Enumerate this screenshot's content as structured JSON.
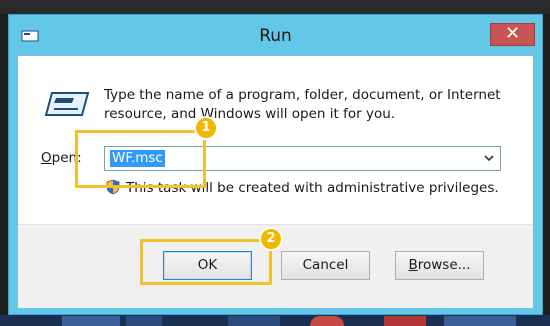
{
  "window": {
    "title": "Run",
    "close_glyph": "✕"
  },
  "dialog": {
    "description": "Type the name of a program, folder, document, or Internet resource, and Windows will open it for you.",
    "open_label_mnemonic": "O",
    "open_label_rest": "pen:",
    "combo_value": "WF.msc",
    "admin_note": "This task will be created with administrative privileges."
  },
  "buttons": {
    "ok": "OK",
    "cancel": "Cancel",
    "browse_mnemonic": "B",
    "browse_rest": "rowse..."
  },
  "annotations": {
    "badge_1": "1",
    "badge_2": "2",
    "highlight_color": "#f2c12e"
  },
  "icons": {
    "run": "run-icon",
    "shield": "uac-shield-icon",
    "dropdown": "chevron-down-icon",
    "close": "close-icon"
  },
  "colors": {
    "title_bar": "#63c7e8",
    "close_button": "#c95454",
    "selection": "#3399ff"
  }
}
